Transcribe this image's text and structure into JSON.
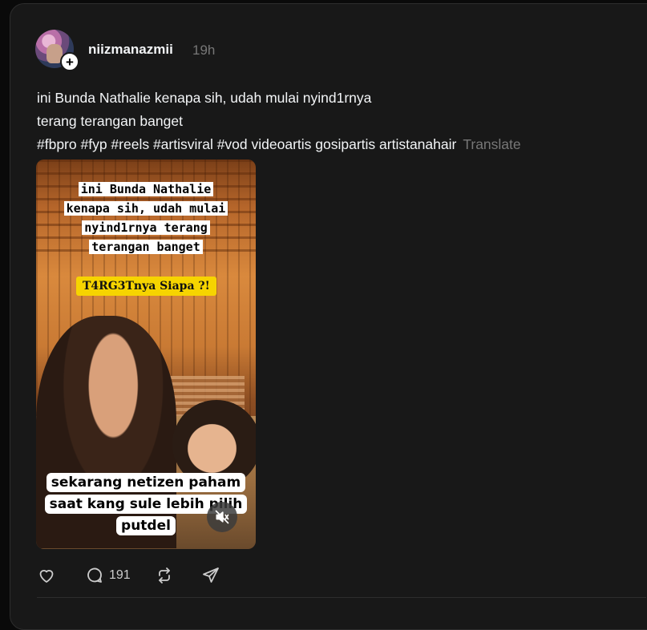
{
  "post": {
    "username": "niizmanazmii",
    "timestamp": "19h",
    "caption_line1": "ini Bunda Nathalie kenapa sih, udah mulai nyind1rnya",
    "caption_line2": "terang terangan banget",
    "hashtags": "#fbpro #fyp #reels #artisviral #vod videoartis gosipartis artistanahair",
    "translate_label": "Translate",
    "follow_icon": "plus-icon"
  },
  "video": {
    "overlay_title": "ini Bunda Nathalie kenapa sih, udah mulai nyind1rnya terang terangan banget",
    "yellow_tag": "T4RG3Tnya Siapa ?!",
    "bottom_caption": "sekarang netizen paham saat kang sule lebih pilih putdel",
    "mute_icon": "muted-speaker-icon"
  },
  "actions": {
    "like_icon": "heart-icon",
    "comment_icon": "comment-icon",
    "comment_count": "191",
    "repost_icon": "repost-icon",
    "share_icon": "share-icon"
  },
  "colors": {
    "background": "#0a0a0a",
    "card": "#181818",
    "text": "#f3f5f7",
    "muted": "#777777",
    "yellow_tag": "#f6d400"
  }
}
